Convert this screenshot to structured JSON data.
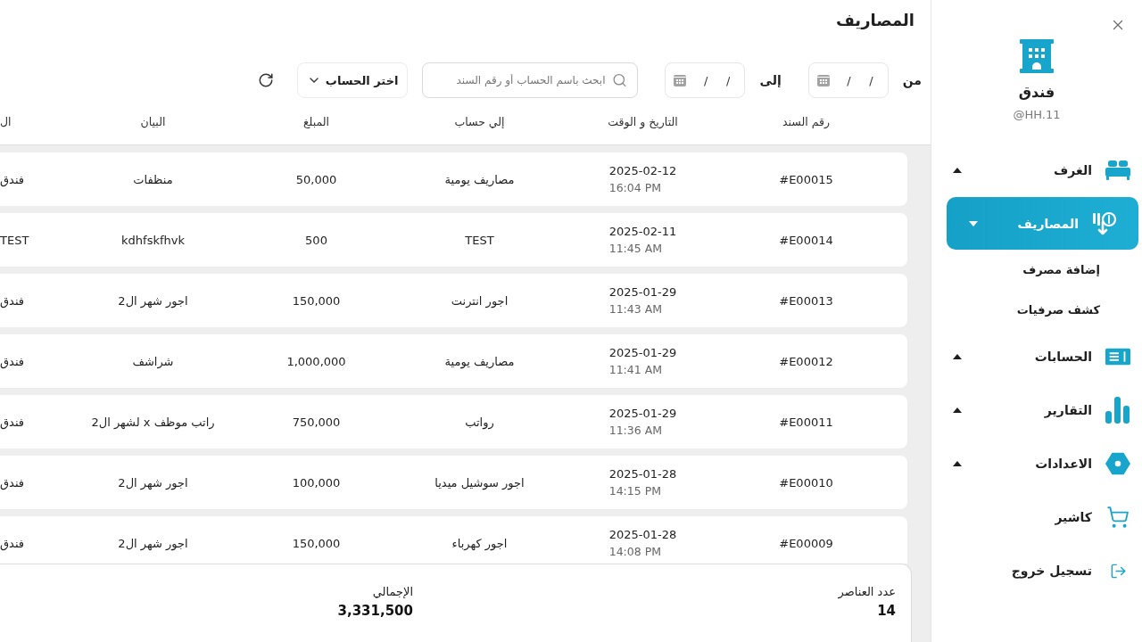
{
  "sidebar": {
    "brand": {
      "name": "فندق",
      "handle": "@HH.11"
    },
    "items": [
      {
        "label": "الغرف",
        "kind": "group",
        "selected": false,
        "expanded": false
      },
      {
        "label": "المصاريف",
        "kind": "group",
        "selected": true,
        "expanded": true,
        "children": [
          {
            "label": "إضافة مصرف"
          },
          {
            "label": "كشف صرفيات"
          }
        ]
      },
      {
        "label": "الحسابات",
        "kind": "group",
        "selected": false,
        "expanded": false
      },
      {
        "label": "التقارير",
        "kind": "group",
        "selected": false,
        "expanded": false
      },
      {
        "label": "الاعدادات",
        "kind": "group",
        "selected": false,
        "expanded": false
      },
      {
        "label": "كاشير",
        "kind": "link",
        "selected": false
      },
      {
        "label": "تسجيل خروج",
        "kind": "link",
        "selected": false
      }
    ]
  },
  "page": {
    "title": "المصاريف"
  },
  "filters": {
    "from": {
      "label": "من",
      "placeholder": "/     /"
    },
    "to": {
      "label": "إلى",
      "placeholder": "/     /"
    },
    "search": {
      "placeholder": "ابحث باسم الحساب أو رقم السند"
    },
    "account_select": {
      "value": "اختر الحساب"
    }
  },
  "table": {
    "columns": [
      "رقم السند",
      "التاريخ و الوقت",
      "إلي حساب",
      "المبلغ",
      "البيان",
      "ال"
    ],
    "rows": [
      {
        "voucher": "#E00015",
        "date": "2025-02-12",
        "time": "16:04 PM",
        "account": "مصاريف يومية",
        "amount": "50,000",
        "description": "منظفات",
        "column_6": "فندق"
      },
      {
        "voucher": "#E00014",
        "date": "2025-02-11",
        "time": "11:45 AM",
        "account": "TEST",
        "amount": "500",
        "description": "kdhfskfhvk",
        "column_6": "TEST"
      },
      {
        "voucher": "#E00013",
        "date": "2025-01-29",
        "time": "11:43 AM",
        "account": "اجور انترنت",
        "amount": "150,000",
        "description": "اجور شهر ال2",
        "column_6": "فندق"
      },
      {
        "voucher": "#E00012",
        "date": "2025-01-29",
        "time": "11:41 AM",
        "account": "مصاريف يومية",
        "amount": "1,000,000",
        "description": "شراشف",
        "column_6": "فندق"
      },
      {
        "voucher": "#E00011",
        "date": "2025-01-29",
        "time": "11:36 AM",
        "account": "رواتب",
        "amount": "750,000",
        "description": "راتب موظف x لشهر ال2",
        "column_6": "فندق"
      },
      {
        "voucher": "#E00010",
        "date": "2025-01-28",
        "time": "14:15 PM",
        "account": "اجور سوشيل ميديا",
        "amount": "100,000",
        "description": "اجور شهر ال2",
        "column_6": "فندق"
      },
      {
        "voucher": "#E00009",
        "date": "2025-01-28",
        "time": "14:08 PM",
        "account": "اجور كهرباء",
        "amount": "150,000",
        "description": "اجور شهر ال2",
        "column_6": "فندق"
      }
    ]
  },
  "summary": {
    "count_label": "عدد العناصر",
    "count": "14",
    "total_label": "الإجمالي",
    "total": "3,331,500"
  }
}
